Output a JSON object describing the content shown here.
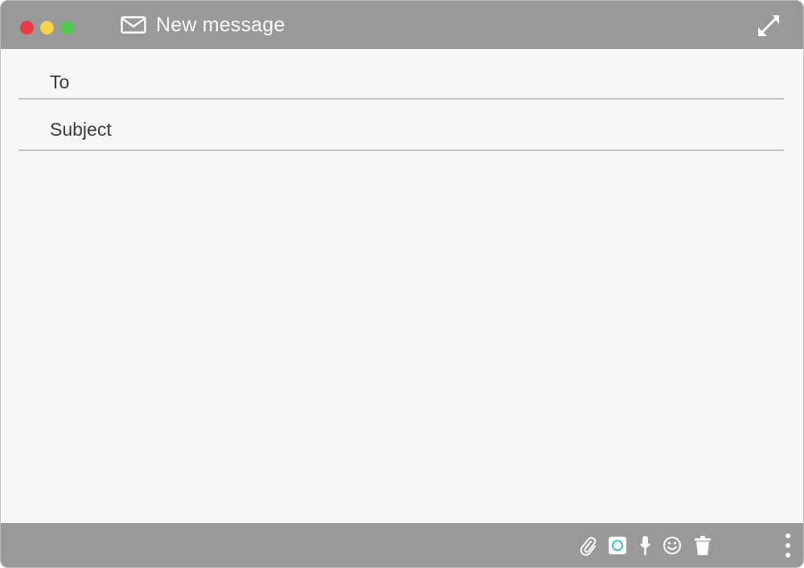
{
  "window": {
    "title": "New message",
    "icons": {
      "mail": "mail-icon",
      "expand": "expand-icon"
    },
    "traffic_lights": {
      "close": "#ee3a47",
      "minimize": "#f2d548",
      "maximize": "#4fca4f"
    }
  },
  "compose": {
    "to_label": "To",
    "to_value": "",
    "subject_label": "Subject",
    "subject_value": "",
    "body_value": ""
  },
  "toolbar": {
    "icons": [
      "paperclip-icon",
      "photo-icon",
      "microphone-icon",
      "emoji-icon",
      "trash-icon",
      "more-vertical-icon"
    ]
  },
  "colors": {
    "titlebar": "#999999",
    "background": "#f8f8f8",
    "label_text": "#3a3a3a",
    "divider": "#c4c4c4",
    "photo_accent": "#3ec4c8"
  }
}
